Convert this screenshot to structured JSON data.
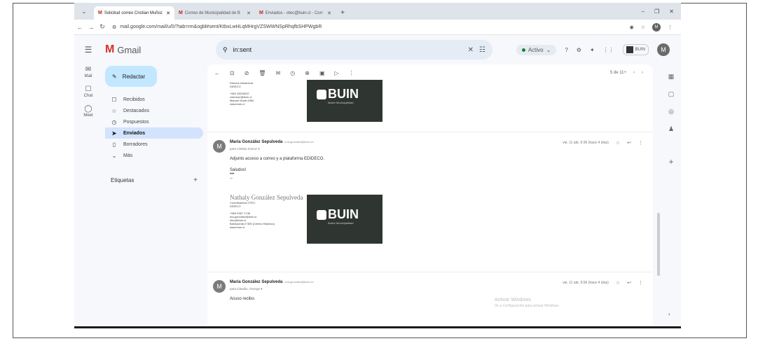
{
  "browser": {
    "tabs": [
      {
        "icon": "M",
        "label": "Solicitud correo Cristian Muñoz",
        "active": true
      },
      {
        "icon": "M",
        "label": "Correo de Municipalidad de B",
        "active": false
      },
      {
        "icon": "M",
        "label": "Enviados - otec@buin.cl - Corr",
        "active": false
      }
    ],
    "url": "mail.google.com/mail/u/0/?tab=rm&ogbl#sent/KtbxLwHLqMHrgVZSWWNSpRhqfbSHPWgbR"
  },
  "gmail": {
    "app_name": "Gmail",
    "search_value": "in:sent",
    "status_label": "Activo",
    "org_badge": "BUIN",
    "user_initial": "M",
    "compose_label": "Redactar",
    "rail": [
      {
        "icon": "mail-icon",
        "glyph": "✉",
        "label": "Mail"
      },
      {
        "icon": "chat-icon",
        "glyph": "☐",
        "label": "Chat"
      },
      {
        "icon": "meet-icon",
        "glyph": "◯",
        "label": "Meet"
      }
    ],
    "nav": [
      {
        "icon": "inbox-icon",
        "glyph": "☐",
        "label": "Recibidos",
        "active": false
      },
      {
        "icon": "star-icon",
        "glyph": "☆",
        "label": "Destacados",
        "active": false
      },
      {
        "icon": "clock-icon",
        "glyph": "◷",
        "label": "Pospuestos",
        "active": false
      },
      {
        "icon": "send-icon",
        "glyph": "➤",
        "label": "Enviados",
        "active": true
      },
      {
        "icon": "draft-icon",
        "glyph": "▯",
        "label": "Borradores",
        "active": false
      },
      {
        "icon": "chevron-down-icon",
        "glyph": "⌄",
        "label": "Más",
        "active": false
      }
    ],
    "labels_heading": "Etiquetas",
    "pager": "5 de 11+"
  },
  "thread": {
    "sig_top": {
      "lines": [
        "Director Asistencia",
        "DIDECO",
        "",
        "+562 28218457",
        "cimmesz@buin.cl",
        "Manuel Montt #354",
        "www.buin.cl"
      ]
    },
    "messages": [
      {
        "initial": "M",
        "sender": "María González Sepulveda",
        "email": "<ma.gonzalez@buin.cl>",
        "to": "para cristian.munoz ▾",
        "date": "vie, 11 abr, 9:36 (hace 4 días)",
        "body_line1": "Adjunto acceso a correo y a plataforma EDIDECO.",
        "body_line2": "Saludos!",
        "ellipsis": "•••",
        "dash": "--",
        "signature": {
          "name": "Nathaly González Sepulveda",
          "lines": [
            "Coordinadora OTEC",
            "DIDECO",
            "",
            "+569 9357 1746",
            "ma.gonzalez@buin.cl",
            "otec@buin.cl",
            "Balmaceda n°305 (Centro Histórico)",
            "www.buin.cl"
          ]
        }
      },
      {
        "initial": "M",
        "sender": "María González Sepulveda",
        "email": "<ma.gonzalez@buin.cl>",
        "to": "para Claudio, George ▾",
        "date": "vie, 11 abr, 9:56 (hace 4 días)",
        "body_line1": "Acuso recibo."
      }
    ],
    "logo_word": "BUIN",
    "logo_sub": "Ilustre Municipalidad"
  },
  "watermark": {
    "line1": "Activar Windows",
    "line2": "Ve a Configuración para activar Windows."
  }
}
